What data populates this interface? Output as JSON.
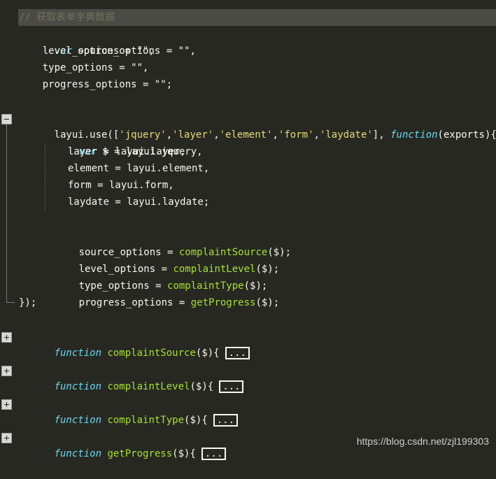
{
  "editor": {
    "comment": "// 获取表单字典数据",
    "kw_var": "var",
    "kw_function": "function",
    "decl": {
      "source": " source_options = \"\",",
      "level": "    level_options = \"\",",
      "type": "    type_options = \"\",",
      "progress": "    progress_options = \"\";"
    },
    "use_line": {
      "head": "layui.use([",
      "s1": "'jquery'",
      "s2": "'layer'",
      "s3": "'element'",
      "s4": "'form'",
      "s5": "'laydate'",
      "comma": ",",
      "mid": "], ",
      "tail": "(exports){"
    },
    "inner": {
      "dollar": " $ = layui.jquery,",
      "layer": "layer = layui.layer,",
      "element": "element = layui.element,",
      "form": "form = layui.form,",
      "laydate": "laydate = layui.laydate;"
    },
    "assign": {
      "source_lhs": "source_options = ",
      "source_fn": "complaintSource",
      "level_lhs": "level_options = ",
      "level_fn": "complaintLevel",
      "type_lhs": "type_options = ",
      "type_fn": "complaintType",
      "progress_lhs": "progress_options = ",
      "progress_fn": "getProgress",
      "arg_end": "($);"
    },
    "close": "});",
    "folded": [
      {
        "name": "complaintSource",
        "sig": "($){"
      },
      {
        "name": "complaintLevel",
        "sig": "($){"
      },
      {
        "name": "complaintType",
        "sig": "($){"
      },
      {
        "name": "getProgress",
        "sig": "($){"
      }
    ],
    "ellipsis": "..."
  },
  "watermark": "https://blog.csdn.net/zjl199303",
  "colors": {
    "background": "#272822",
    "keyword": "#66d9ef",
    "string": "#e6db74",
    "function": "#a6e22e",
    "comment": "#75715e",
    "text": "#f8f8f2"
  },
  "icons": {
    "collapse": "fold-minus-icon",
    "expand": "fold-plus-icon"
  }
}
